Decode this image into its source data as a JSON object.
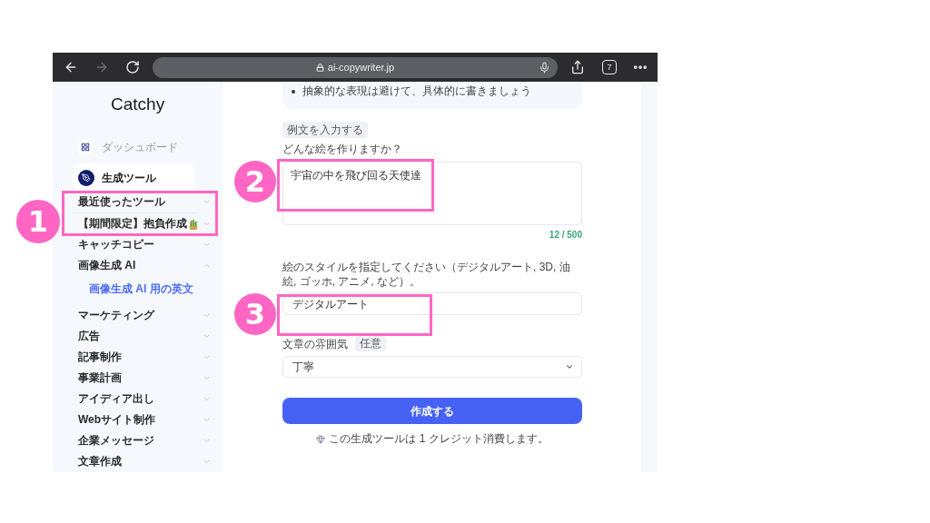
{
  "browser": {
    "forward_disabled": true,
    "url": "ai-copywriter.jp",
    "tab_count": "7"
  },
  "sidebar": {
    "logo": "Catchy",
    "nav": [
      {
        "label": "ダッシュボード",
        "selected": false
      },
      {
        "label": "生成ツール",
        "selected": true
      }
    ],
    "categories": [
      {
        "kind": "category",
        "label": "最近使ったツール",
        "expanded": false
      },
      {
        "kind": "seasonal",
        "label": "【期間限定】抱負作成",
        "expanded": false
      },
      {
        "kind": "category",
        "label": "キャッチコピー",
        "expanded": false
      },
      {
        "kind": "category",
        "label": "画像生成 AI",
        "expanded": true,
        "children": [
          {
            "label": "画像生成 AI 用の英文",
            "selected": true
          }
        ]
      },
      {
        "kind": "category",
        "label": "マーケティング",
        "expanded": false
      },
      {
        "kind": "category",
        "label": "広告",
        "expanded": false
      },
      {
        "kind": "category",
        "label": "記事制作",
        "expanded": false
      },
      {
        "kind": "category",
        "label": "事業計画",
        "expanded": false
      },
      {
        "kind": "category",
        "label": "アイディア出し",
        "expanded": false
      },
      {
        "kind": "category",
        "label": "Webサイト制作",
        "expanded": false
      },
      {
        "kind": "category",
        "label": "企業メッセージ",
        "expanded": false
      },
      {
        "kind": "category",
        "label": "文章作成",
        "expanded": false
      }
    ]
  },
  "form": {
    "tips": [
      "抽象的な表現は避けて、具体的に書きましょう"
    ],
    "example_button": "例文を入力する",
    "fields": [
      {
        "kind": "textarea",
        "label": "どんな絵を作りますか？",
        "value": "宇宙の中を飛び回る天使達",
        "counter": "12 / 500"
      },
      {
        "kind": "input",
        "label": "絵のスタイルを指定してください（デジタルアート, 3D, 油絵, ゴッホ, アニメ, など）。",
        "value": "デジタルアート"
      },
      {
        "kind": "select",
        "label": "文章の雰囲気",
        "badge": "任意",
        "value": "丁寧"
      }
    ],
    "submit": "作成する",
    "credit_note": "この生成ツールは 1 クレジット消費します。"
  },
  "annotations": [
    {
      "number": "1"
    },
    {
      "number": "2"
    },
    {
      "number": "3"
    }
  ]
}
